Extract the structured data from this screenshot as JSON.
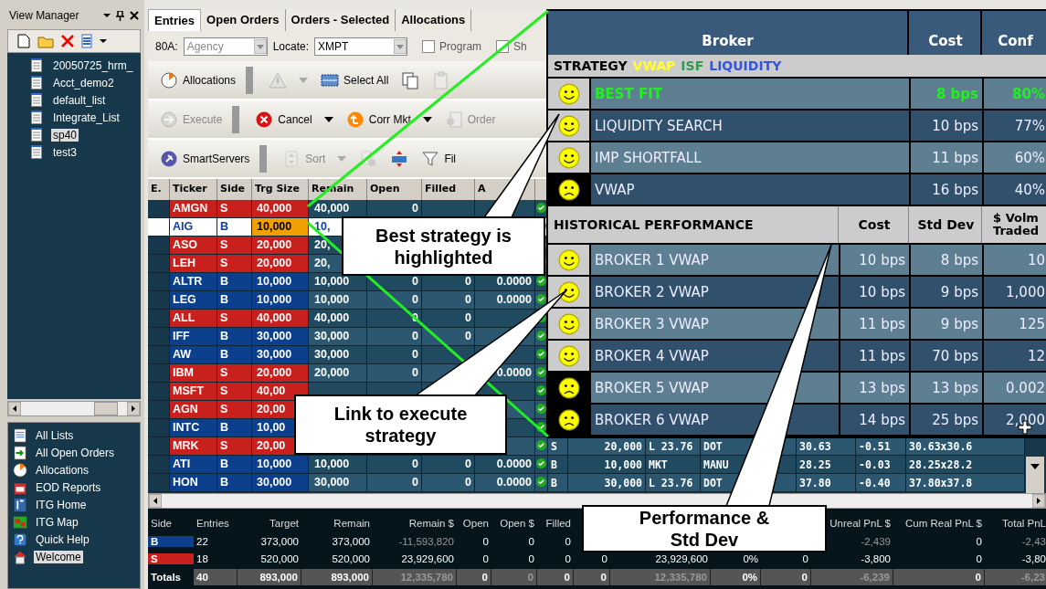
{
  "view_manager": {
    "title": "View Manager",
    "lists": [
      {
        "label": "20050725_hrm_",
        "selected": false
      },
      {
        "label": "Acct_demo2",
        "selected": false
      },
      {
        "label": "default_list",
        "selected": false
      },
      {
        "label": "Integrate_List",
        "selected": false
      },
      {
        "label": "sp40",
        "selected": true
      },
      {
        "label": "test3",
        "selected": false
      }
    ]
  },
  "navigation": [
    {
      "label": "All Lists",
      "selected": false
    },
    {
      "label": "All Open Orders",
      "selected": false
    },
    {
      "label": "Allocations",
      "selected": false
    },
    {
      "label": "EOD Reports",
      "selected": false
    },
    {
      "label": "ITG Home",
      "selected": false
    },
    {
      "label": "ITG Map",
      "selected": false
    },
    {
      "label": "Quick Help",
      "selected": false
    },
    {
      "label": "Welcome",
      "selected": true
    }
  ],
  "tabs": [
    {
      "label": "Entries",
      "selected": true
    },
    {
      "label": "Open Orders",
      "selected": false
    },
    {
      "label": "Orders - Selected",
      "selected": false
    },
    {
      "label": "Allocations",
      "selected": false
    }
  ],
  "filters": {
    "dropdowns": [
      {
        "label": "80A:",
        "value": "Agency",
        "disabled": true
      },
      {
        "label": "Locate:",
        "value": "XMPT",
        "disabled": false
      }
    ],
    "checkboxes": [
      {
        "label": "Program",
        "checked": false,
        "disabled": true
      },
      {
        "label": "Sh",
        "checked": false,
        "disabled": true
      }
    ]
  },
  "toolbars": [
    [
      {
        "label": "Allocations",
        "disabled": false,
        "menu": false
      },
      {
        "disabled": true,
        "menu": true
      },
      {
        "label": "Select All",
        "disabled": false,
        "menu": false
      },
      {
        "disabled": false,
        "menu": false
      },
      {
        "disabled": true,
        "menu": false
      }
    ],
    [
      {
        "label": "Execute",
        "disabled": true,
        "menu": false
      },
      {
        "label": "Cancel",
        "disabled": false,
        "menu": true
      },
      {
        "label": "Corr Mkt",
        "disabled": false,
        "menu": true
      },
      {
        "label": "Order",
        "disabled": true,
        "menu": false
      }
    ],
    [
      {
        "label": "SmartServers",
        "disabled": false,
        "menu": false
      },
      {
        "label": "Sort",
        "disabled": true,
        "menu": true
      },
      {
        "disabled": true,
        "menu": false
      },
      {
        "disabled": false,
        "menu": false
      },
      {
        "label": "Fil",
        "disabled": false,
        "menu": false
      }
    ]
  ],
  "grid": {
    "columns": [
      "E.",
      "Ticker",
      "Side",
      "Trg Size",
      "Remain",
      "Open",
      "Filled",
      "A"
    ],
    "rows": [
      {
        "ticker": "AMGN",
        "side": "S",
        "kind": "sell",
        "trg_size": "40,000",
        "remain": "40,000",
        "open": "0",
        "selected": false
      },
      {
        "ticker": "AIG",
        "side": "B",
        "kind": "buy",
        "trg_size": "10,000",
        "remain": "10,",
        "selected": true
      },
      {
        "ticker": "ASO",
        "side": "S",
        "kind": "sell",
        "trg_size": "20,000",
        "remain": "20,",
        "selected": false
      },
      {
        "ticker": "LEH",
        "side": "S",
        "kind": "sell",
        "trg_size": "20,000",
        "remain": "20,",
        "selected": false
      },
      {
        "ticker": "ALTR",
        "side": "B",
        "kind": "buy",
        "trg_size": "10,000",
        "remain": "10,000",
        "open": "0",
        "filled": "0",
        "avg": "0.0000",
        "selected": false
      },
      {
        "ticker": "LEG",
        "side": "B",
        "kind": "buy",
        "trg_size": "10,000",
        "remain": "10,000",
        "open": "0",
        "filled": "0",
        "avg": "0.0000",
        "selected": false
      },
      {
        "ticker": "ALL",
        "side": "S",
        "kind": "sell",
        "trg_size": "40,000",
        "remain": "40,000",
        "open": "0",
        "filled": "0",
        "selected": false
      },
      {
        "ticker": "IFF",
        "side": "B",
        "kind": "buy",
        "trg_size": "30,000",
        "remain": "30,000",
        "open": "0",
        "filled": "0",
        "selected": false
      },
      {
        "ticker": "AW",
        "side": "B",
        "kind": "buy",
        "trg_size": "30,000",
        "remain": "30,000",
        "open": "0",
        "selected": false
      },
      {
        "ticker": "IBM",
        "side": "S",
        "kind": "sell",
        "trg_size": "20,000",
        "remain": "20,000",
        "open": "0",
        "avg": "0.0000",
        "selected": false
      },
      {
        "ticker": "MSFT",
        "side": "S",
        "kind": "sell",
        "trg_size": "40,00",
        "selected": false
      },
      {
        "ticker": "AGN",
        "side": "S",
        "kind": "sell",
        "trg_size": "20,00",
        "selected": false
      },
      {
        "ticker": "INTC",
        "side": "B",
        "kind": "buy",
        "trg_size": "10,00",
        "selected": false
      },
      {
        "ticker": "MRK",
        "side": "S",
        "kind": "sell",
        "trg_size": "20,00",
        "selected": false,
        "extra": {
          "side": "S",
          "size": "20,000",
          "price": "L 23.76",
          "dest": "DOT",
          "last": "30.63",
          "change": "-0.51",
          "quote": "30.63x30.6"
        }
      },
      {
        "ticker": "ATI",
        "side": "B",
        "kind": "buy",
        "trg_size": "10,000",
        "remain": "10,000",
        "open": "0",
        "filled": "0",
        "avg": "0.0000",
        "selected": false,
        "extra": {
          "side": "B",
          "size": "10,000",
          "price": "MKT",
          "dest": "MANU",
          "last": "28.25",
          "change": "-0.03",
          "quote": "28.25x28.2"
        }
      },
      {
        "ticker": "HON",
        "side": "B",
        "kind": "buy",
        "trg_size": "30,000",
        "remain": "30,000",
        "open": "0",
        "filled": "0",
        "avg": "0.0000",
        "selected": false,
        "extra": {
          "side": "B",
          "size": "30,000",
          "price": "L 23.76",
          "dest": "DOT",
          "last": "37.80",
          "change": "-0.40",
          "quote": "37.80x37.8"
        }
      }
    ]
  },
  "summary": {
    "columns": [
      "Side",
      "Entries",
      "Target",
      "Remain",
      "Remain $",
      "Open",
      "Open $",
      "Filled",
      "Unreal PnL $",
      "Cum Real PnL $",
      "Total PnL"
    ],
    "rows": [
      {
        "kind": "buy",
        "side": "B",
        "entries": "22",
        "target": "373,000",
        "remain": "373,000",
        "remain_usd": "-11,593,820",
        "open": "0",
        "open_usd": "0",
        "filled": "0",
        "unreal_pnl": "-2,439",
        "cum_real_pnl": "0",
        "total_pnl": "-2,43"
      },
      {
        "kind": "sell",
        "side": "S",
        "entries": "18",
        "target": "520,000",
        "remain": "520,000",
        "remain_usd": "23,929,600",
        "open": "0",
        "open_usd": "0",
        "filled": "0",
        "column_9": "0",
        "column_10": "23,929,600",
        "column_11": "0%",
        "column_12": "0",
        "unreal_pnl": "-3,800",
        "cum_real_pnl": "0",
        "total_pnl": "-3,80"
      },
      {
        "kind": "total",
        "side": "Totals",
        "entries": "40",
        "target": "893,000",
        "remain": "893,000",
        "remain_usd": "12,335,780",
        "open": "0",
        "open_usd": "0",
        "filled": "0",
        "column_9": "0",
        "column_10": "12,335,780",
        "column_11": "0%",
        "column_12": "0",
        "unreal_pnl": "-6,239",
        "cum_real_pnl": "0",
        "total_pnl": "-6,23"
      }
    ]
  },
  "strategy_popup": {
    "columns": [
      "Broker",
      "Cost",
      "Conf"
    ],
    "legend": [
      {
        "text": "STRATEGY",
        "color": "#000000"
      },
      {
        "text": "VWAP",
        "color": "#ffff33"
      },
      {
        "text": "ISF",
        "color": "#339955"
      },
      {
        "text": "LIQUIDITY",
        "color": "#3355dd"
      }
    ],
    "strategies": [
      {
        "name": "BEST FIT",
        "cost": "8 bps",
        "conf": "80%",
        "kind": "happy",
        "selected": true
      },
      {
        "name": "LIQUIDITY SEARCH",
        "cost": "10 bps",
        "conf": "77%",
        "kind": "happy",
        "selected": false
      },
      {
        "name": "IMP SHORTFALL",
        "cost": "11 bps",
        "conf": "60%",
        "kind": "happy",
        "selected": false
      },
      {
        "name": "VWAP",
        "cost": "16 bps",
        "conf": "40%",
        "kind": "sad",
        "selected": false
      }
    ],
    "history_columns": [
      "HISTORICAL PERFORMANCE",
      "Cost",
      "Std Dev",
      "$ Volm Traded"
    ],
    "history": [
      {
        "name": "BROKER 1 VWAP",
        "cost": "10 bps",
        "std_dev": "8 bps",
        "volume": "10",
        "kind": "happy"
      },
      {
        "name": "BROKER 2 VWAP",
        "cost": "10 bps",
        "std_dev": "9 bps",
        "volume": "1,000",
        "kind": "happy"
      },
      {
        "name": "BROKER 3 VWAP",
        "cost": "11 bps",
        "std_dev": "9 bps",
        "volume": "125",
        "kind": "happy"
      },
      {
        "name": "BROKER 4 VWAP",
        "cost": "11 bps",
        "std_dev": "70 bps",
        "volume": "12",
        "kind": "happy"
      },
      {
        "name": "BROKER 5 VWAP",
        "cost": "13 bps",
        "std_dev": "13 bps",
        "volume": "0.002",
        "kind": "sad"
      },
      {
        "name": "BROKER 6 VWAP",
        "cost": "14 bps",
        "std_dev": "25 bps",
        "volume": "2,000",
        "kind": "sad"
      }
    ]
  },
  "callouts": [
    "Best strategy is highlighted",
    "Link to execute strategy",
    "Performance & Std Dev"
  ]
}
